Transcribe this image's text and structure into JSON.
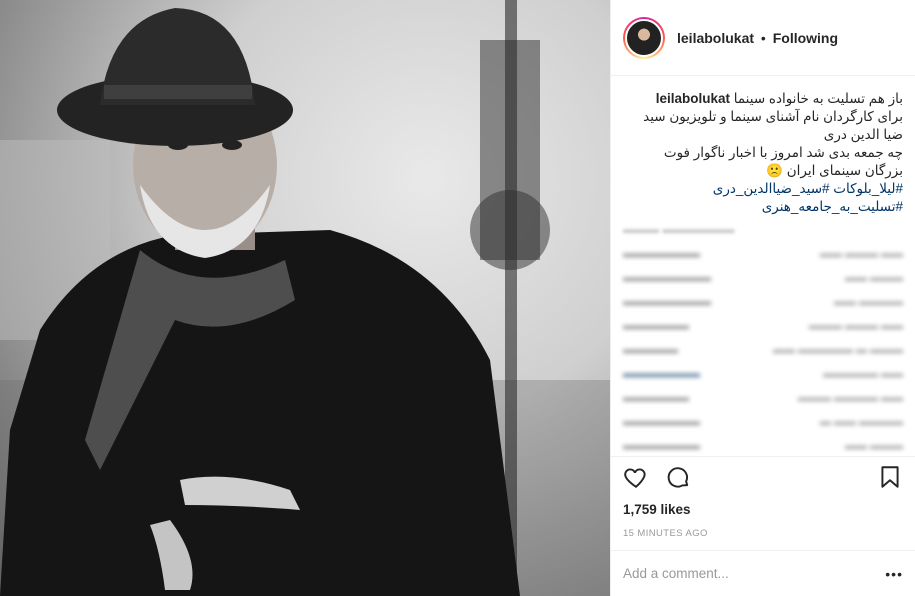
{
  "post": {
    "author": "leilabolukat",
    "follow_state": "Following",
    "separator": "•",
    "caption": {
      "username": "leilabolukat",
      "line1": "باز هم تسلیت به خانواده سینما",
      "line2": "برای کارگردان نام آشنای سینما و تلویزیون سید",
      "line3": "ضیا الدین دری",
      "line4": "چه جمعه بدی شد امروز با اخبار ناگوار فوت",
      "line5": "بزرگان سینمای ایران",
      "emoji": "🙁",
      "hashtag1": "#لیلا_بلوکات",
      "hashtag2": "#سید_ضیاالدین_دری",
      "hashtag3": "#تسلیت_به_جامعه_هنری"
    },
    "likes": "1,759 likes",
    "timestamp": "15 MINUTES AGO",
    "comment_placeholder": "Add a comment...",
    "more": "•••"
  },
  "icons": {
    "like": "heart-icon",
    "comment": "comment-icon",
    "save": "bookmark-icon"
  },
  "colors": {
    "link": "#003569",
    "text": "#262626",
    "muted": "#999999",
    "border": "#efefef"
  }
}
